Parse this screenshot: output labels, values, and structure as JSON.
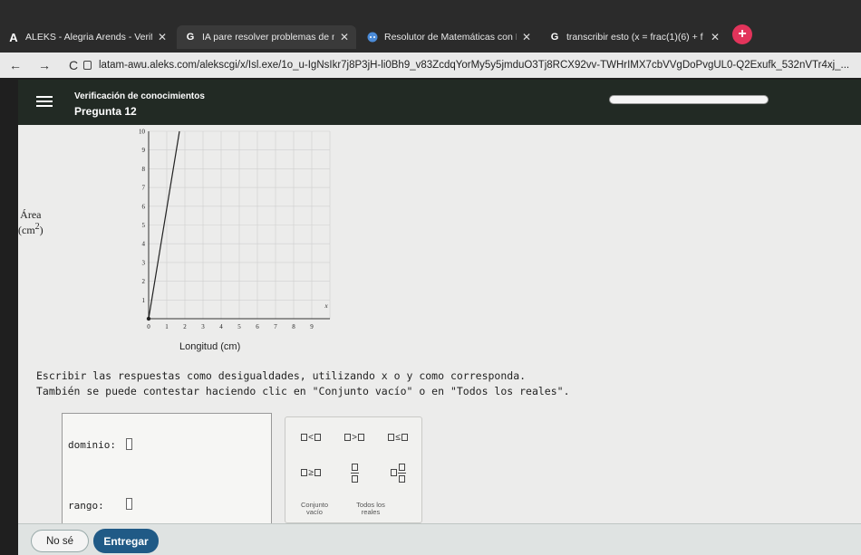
{
  "browser": {
    "tabs": [
      {
        "icon": "aleks-logo-icon",
        "title": "ALEKS - Alegria Arends - Verifica"
      },
      {
        "icon": "google-icon",
        "title": "IA pare resolver problemas de m"
      },
      {
        "icon": "solver-icon",
        "title": "Resolutor de Matemáticas con IA"
      },
      {
        "icon": "google-icon",
        "title": "transcribir esto (x = frac(1)(6) + f"
      }
    ],
    "url": "latam-awu.aleks.com/alekscgi/x/Isl.exe/1o_u-IgNsIkr7j8P3jH-li0Bh9_v83ZcdqYorMy5y5jmduO3Tj8RCX92vv-TWHrIMX7cbVVgDoPvgUL0-Q2Exufk_532nVTr4xj_..."
  },
  "header": {
    "subtitle": "Verificación de conocimientos",
    "title": "Pregunta 12"
  },
  "chart_data": {
    "type": "line",
    "title": "",
    "ylabel": "Área",
    "ylabel_unit": "(cm",
    "ylabel_exp": "2",
    "ylabel_close": ")",
    "xlabel": "Longitud (cm)",
    "x_var": "x",
    "xlim": [
      0,
      10
    ],
    "ylim": [
      0,
      10
    ],
    "x_ticks": [
      0,
      1,
      2,
      3,
      4,
      5,
      6,
      7,
      8,
      9
    ],
    "y_ticks": [
      1,
      2,
      3,
      4,
      5,
      6,
      7,
      8,
      9,
      10
    ],
    "grid": true,
    "series": [
      {
        "x": [
          0,
          1.7
        ],
        "y": [
          0,
          10
        ],
        "color": "#222222"
      }
    ],
    "points": [
      {
        "x": 0,
        "y": 0,
        "filled": true
      }
    ]
  },
  "instructions": {
    "line1": "Escribir las respuestas como desigualdades, utilizando x o y como corresponda.",
    "line2": "También se puede contestar haciendo clic en \"Conjunto vacío\" o en \"Todos los reales\"."
  },
  "answer": {
    "domain_label": "dominio:",
    "range_label": "rango:",
    "domain_value": "",
    "range_value": ""
  },
  "keypad": {
    "lt": "<",
    "gt": ">",
    "le": "≤",
    "ge": "≥",
    "empty_set": "Conjunto vacío",
    "all_reals": "Todos los reales"
  },
  "footer": {
    "dont_know": "No sé",
    "submit": "Entregar"
  }
}
